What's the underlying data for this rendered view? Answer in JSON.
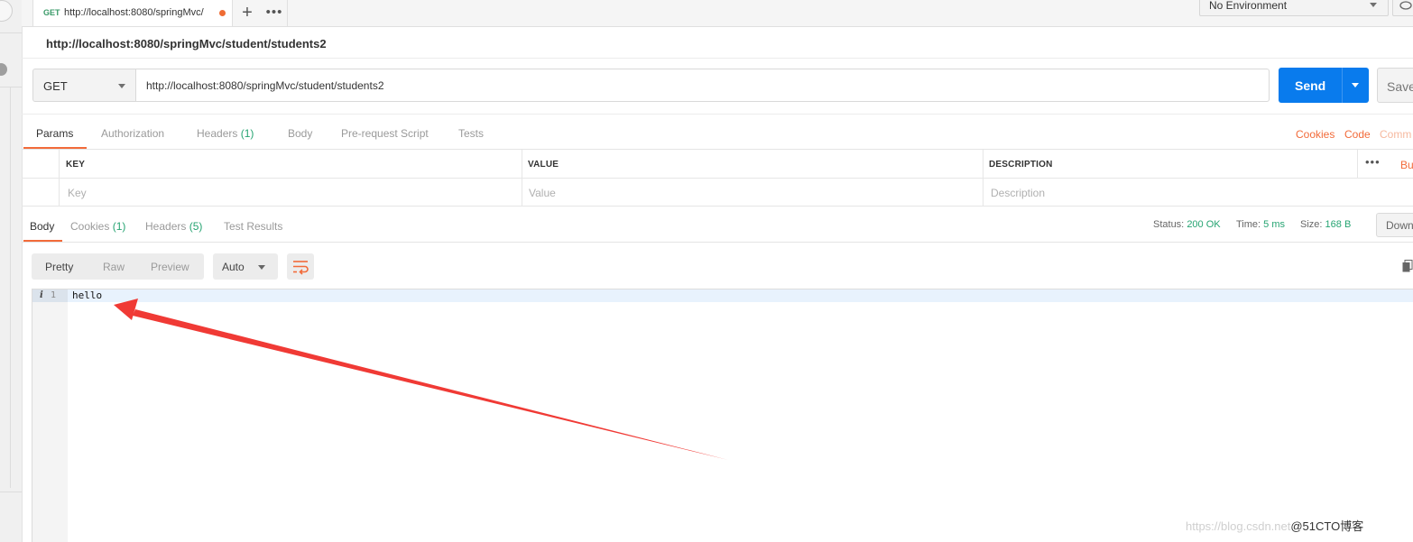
{
  "tab": {
    "method": "GET",
    "url": "http://localhost:8080/springMvc/",
    "new_tab_icon": "+",
    "more_icon": "•••"
  },
  "environment": {
    "selected": "No Environment"
  },
  "request": {
    "title": "http://localhost:8080/springMvc/student/students2",
    "method": "GET",
    "url": "http://localhost:8080/springMvc/student/students2",
    "send_label": "Send",
    "save_label": "Save"
  },
  "request_tabs": [
    {
      "label": "Params",
      "count": ""
    },
    {
      "label": "Authorization",
      "count": ""
    },
    {
      "label": "Headers",
      "count": "(1)"
    },
    {
      "label": "Body",
      "count": ""
    },
    {
      "label": "Pre-request Script",
      "count": ""
    },
    {
      "label": "Tests",
      "count": ""
    }
  ],
  "request_links": {
    "cookies": "Cookies",
    "code": "Code",
    "comments": "Comm"
  },
  "params_table": {
    "headers": [
      "KEY",
      "VALUE",
      "DESCRIPTION"
    ],
    "placeholders": [
      "Key",
      "Value",
      "Description"
    ],
    "more": "•••",
    "bulk_edit": "Bu"
  },
  "response_tabs": [
    {
      "label": "Body",
      "count": ""
    },
    {
      "label": "Cookies",
      "count": "(1)"
    },
    {
      "label": "Headers",
      "count": "(5)"
    },
    {
      "label": "Test Results",
      "count": ""
    }
  ],
  "response_meta": {
    "status_label": "Status:",
    "status_value": "200 OK",
    "time_label": "Time:",
    "time_value": "5 ms",
    "size_label": "Size:",
    "size_value": "168 B",
    "download_label": "Down"
  },
  "view_options": {
    "modes": [
      "Pretty",
      "Raw",
      "Preview"
    ],
    "active_mode": "Pretty",
    "format": "Auto",
    "wrap_icon": "wrap-lines-icon"
  },
  "response_body": {
    "line_number": "1",
    "line_info_icon": "i",
    "text": "hello"
  },
  "colors": {
    "accent": "#f26b3a",
    "send": "#097bed",
    "success": "#26a472",
    "annotation_arrow": "#f03a35"
  },
  "watermark": {
    "url": "https://blog.csdn.net",
    "brand": "@51CTO博客"
  }
}
